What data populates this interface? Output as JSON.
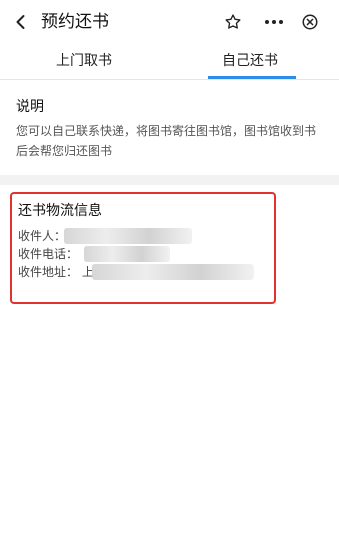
{
  "header": {
    "title": "预约还书",
    "back_icon": "chevron-left-icon",
    "star_icon": "star-outline-icon",
    "more_icon": "more-horizontal-icon",
    "close_icon": "close-circle-icon"
  },
  "tabs": [
    {
      "label": "上门取书",
      "active": false
    },
    {
      "label": "自己还书",
      "active": true
    }
  ],
  "info": {
    "title": "说明",
    "text": "您可以自己联系快递，将图书寄往图书馆，图书馆收到书后会帮您归还图书"
  },
  "return_info": {
    "title": "还书物流信息",
    "recipient_label": "收件人：",
    "phone_label": "收件电话：",
    "address_label": "收件地址：",
    "address_prefix": "上"
  },
  "colors": {
    "accent": "#2e8be8",
    "highlight_border": "#e0332e",
    "divider": "#f2f2f2"
  }
}
